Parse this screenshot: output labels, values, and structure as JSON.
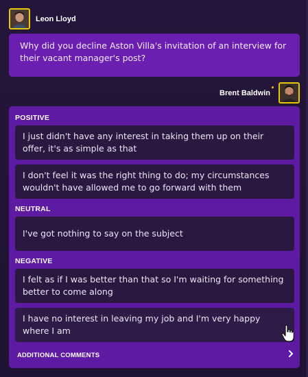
{
  "interviewer": {
    "name": "Leon Lloyd",
    "avatar_icon": "journalist-avatar"
  },
  "question": "Why did you decline Aston Villa's invitation of an interview for their vacant manager's post?",
  "respondent": {
    "name": "Brent Baldwin",
    "avatar_icon": "manager-avatar"
  },
  "sections": {
    "positive": {
      "label": "POSITIVE",
      "options": [
        "I just didn't have any interest in taking them up on their offer, it's as simple as that",
        "I don't feel it was the right thing to do; my circumstances wouldn't have allowed me to go forward with them"
      ]
    },
    "neutral": {
      "label": "NEUTRAL",
      "options": [
        "I've got nothing to say on the subject"
      ]
    },
    "negative": {
      "label": "NEGATIVE",
      "options": [
        "I felt as if I was better than that so I'm waiting for something better to come along",
        "I have no interest in leaving my job and I'm very happy where I am"
      ]
    }
  },
  "additional_comments": "ADDITIONAL COMMENTS",
  "colors": {
    "background": "#1e1233",
    "question_bg": "#6b1fb0",
    "panel_bg": "#5e1aa3",
    "option_bg": "#2a1840",
    "avatar_border": "#e8c800"
  }
}
